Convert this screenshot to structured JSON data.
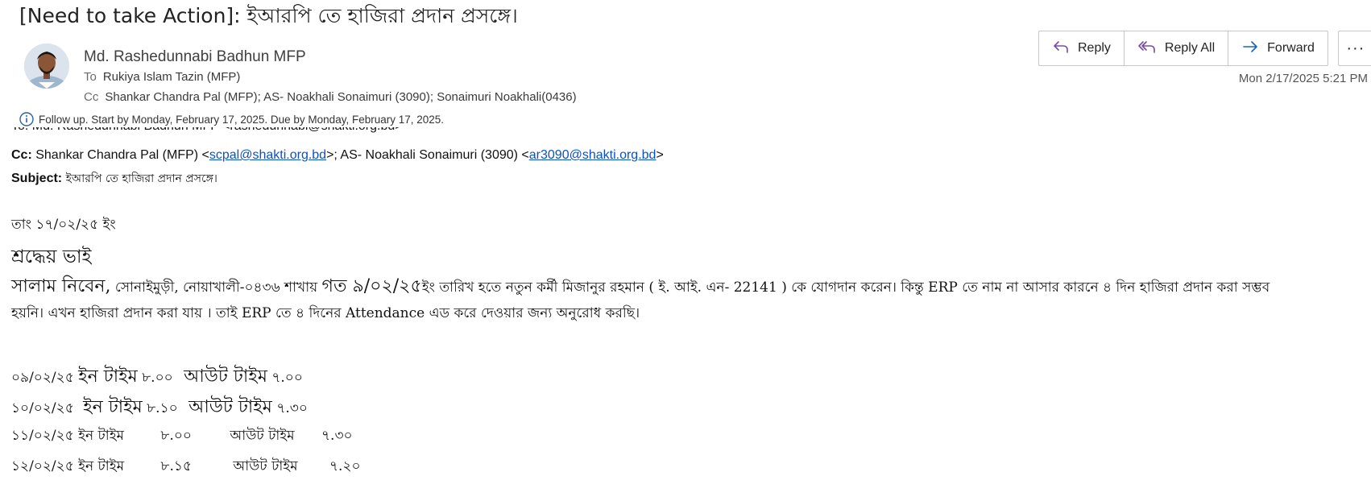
{
  "email": {
    "subject": "[Need to take Action]: ইআরপি তে হাজিরা প্রদান প্রসঙ্গে।",
    "sender": "Md. Rashedunnabi Badhun MFP",
    "to_label": "To",
    "to": "Rukiya Islam Tazin (MFP)",
    "cc_label": "Cc",
    "cc": "Shankar Chandra Pal (MFP); AS- Noakhali Sonaimuri (3090); Sonaimuri Noakhali(0436)",
    "followup": "Follow up.  Start by Monday, February 17, 2025.  Due by Monday, February 17, 2025.",
    "timestamp": "Mon 2/17/2025 5:21 PM"
  },
  "actions": {
    "reply": "Reply",
    "reply_all": "Reply All",
    "forward": "Forward",
    "more": "···"
  },
  "quoted": {
    "to_clip": "To: Md. Rashedunnabi Badhun MFP <rashedunnabi@shakti.org.bd>",
    "cc_label": "Cc:",
    "cc_text1": " Shankar Chandra Pal (MFP) <",
    "cc_email1": "scpal@shakti.org.bd",
    "cc_text2": ">; AS- Noakhali Sonaimuri (3090) <",
    "cc_email2": "ar3090@shakti.org.bd",
    "cc_text3": ">",
    "subject_label": "Subject:",
    "subject_value": " ইআরপি তে হাজিরা প্রদান প্রসঙ্গে।"
  },
  "body": {
    "date": "তাং ১৭/০২/২৫ ইং",
    "greeting": "শ্রদ্ধেয়  ভাই",
    "para1_big": "সালাম  নিবেন,",
    "para1_a": " সোনাইমুড়ী, নোয়াখালী-০৪৩৬ শাখায় ",
    "para1_big2": " গত  ৯/০২/২৫",
    "para1_b": "ইং তারিখ হতে নতুন কর্মী মিজানুর রহমান ( ই. আই. এন- 22141 ) কে যোগদান করেন। কিন্তু ERP তে নাম না আসার কারনে ৪ দিন হাজিরা প্রদান করা সম্ভব",
    "para2": "হয়নি। এখন হাজিরা প্রদান করা যায় । তাই ERP তে ৪ দিনের  Attendance এড করে দেওয়ার জন্য অনুরোধ করছি।",
    "rows": [
      {
        "date": "০৯/০২/২৫",
        "in_label": "ইন  টাইম",
        "in_time": "৮.০০",
        "out_label": "আউট  টাইম",
        "out_time": "৭.০০"
      },
      {
        "date": "১০/০২/২৫",
        "in_label": "ইন  টাইম",
        "in_time": "৮.১০",
        "out_label": "আউট  টাইম",
        "out_time": "৭.৩০"
      },
      {
        "date": "১১/০২/২৫",
        "in_label": "ইন টাইম",
        "in_time": "৮.০০",
        "out_label": "আউট টাইম",
        "out_time": "৭.৩০"
      },
      {
        "date": "১২/০২/২৫",
        "in_label": "ইন টাইম",
        "in_time": "৮.১৫",
        "out_label": "আউট টাইম",
        "out_time": "৭.২০"
      }
    ]
  }
}
